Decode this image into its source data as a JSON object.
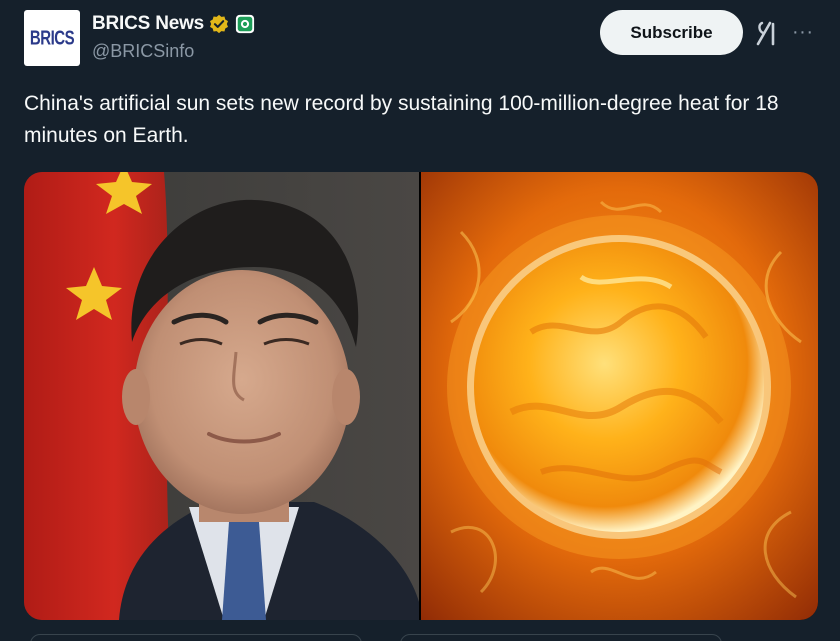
{
  "account": {
    "display_name": "BRICS News",
    "handle": "@BRICSinfo",
    "avatar_text": "BRICS",
    "verified_badge_color": "#e2b719",
    "affiliate_badge_color": "#1d9e58"
  },
  "actions": {
    "subscribe_label": "Subscribe",
    "grok_icon": "grok-icon",
    "more_icon": "more-icon",
    "more_glyph": "···"
  },
  "post": {
    "text": "China's artificial sun sets new record by sustaining 100-million-degree heat for 18 minutes on Earth."
  },
  "media": {
    "left_image": "portrait-photo",
    "right_image": "sun-photo",
    "colors": {
      "flag_red": "#d1281f",
      "flag_star": "#f5c52a",
      "sun_core": "#ffb21a",
      "sun_outer": "#c43c06"
    }
  },
  "theme": {
    "background": "#15202b",
    "text_primary": "#f7f9f9",
    "text_secondary": "#8b98a5",
    "button_bg": "#eff3f4"
  }
}
